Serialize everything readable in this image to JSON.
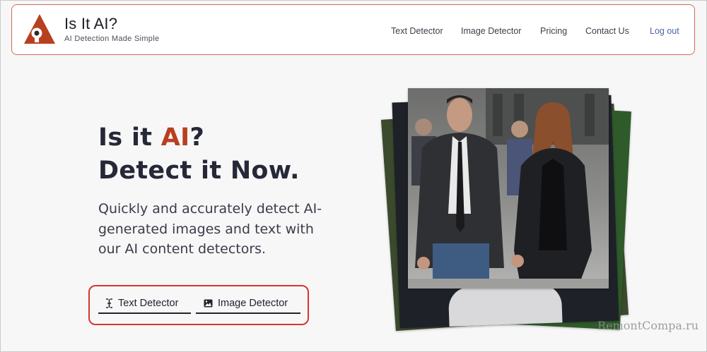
{
  "header": {
    "brand_title": "Is It AI?",
    "brand_tagline": "AI Detection Made Simple",
    "logo_icon": "triangle-eye-logo",
    "nav": [
      {
        "label": "Text Detector"
      },
      {
        "label": "Image Detector"
      },
      {
        "label": "Pricing"
      },
      {
        "label": "Contact Us"
      },
      {
        "label": "Log out"
      }
    ]
  },
  "hero": {
    "heading_prefix": "Is it ",
    "heading_accent": "AI",
    "heading_suffix": "?",
    "heading_line2": "Detect it Now.",
    "description": "Quickly and accurately detect AI-generated images and text with our AI content detectors.",
    "buttons": [
      {
        "label": "Text Detector",
        "icon": "text-cursor-icon"
      },
      {
        "label": "Image Detector",
        "icon": "image-icon"
      }
    ]
  },
  "watermark": "RemontCompa.ru",
  "colors": {
    "accent": "#b8401f",
    "header_border": "#d06a5a",
    "highlight_border": "#d9352e",
    "logout_link": "#4c66a8"
  }
}
